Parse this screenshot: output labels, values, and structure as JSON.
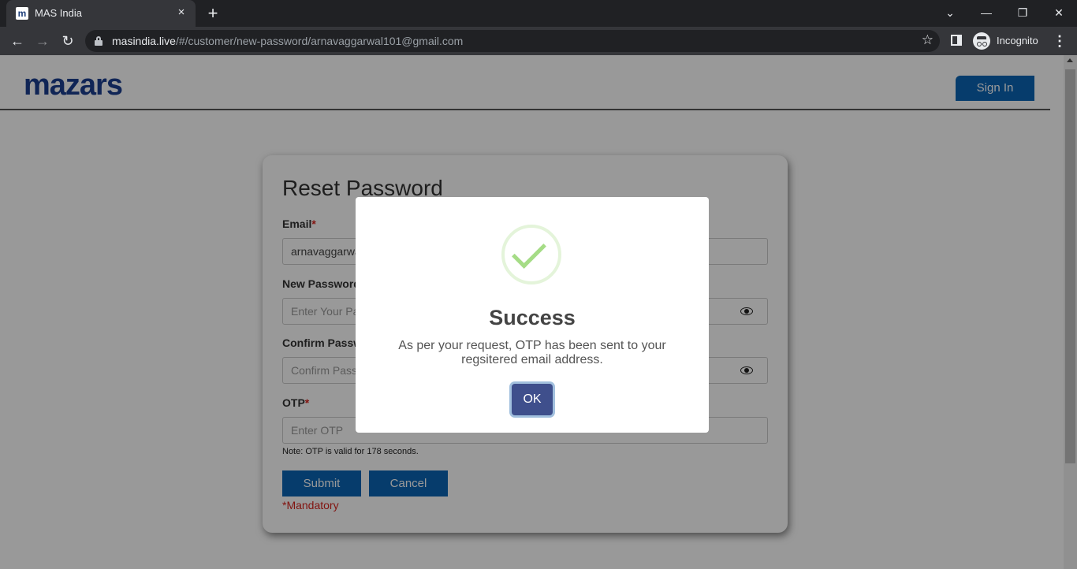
{
  "browser": {
    "tab_title": "MAS India",
    "favicon_letter": "m",
    "tab_close_icon": "×",
    "new_tab_icon": "+",
    "window_controls": {
      "chevron": "⌄",
      "minimize": "—",
      "restore": "❐",
      "close": "✕"
    },
    "back_icon": "←",
    "forward_icon": "→",
    "reload_icon": "↻",
    "url_host": "masindia.live",
    "url_path": "/#/customer/new-password/arnavaggarwal101@gmail.com",
    "star_icon": "☆",
    "incognito_label": "Incognito",
    "menu_icon": "⋮"
  },
  "header": {
    "logo_text": "mazars",
    "sign_in_label": "Sign In"
  },
  "form": {
    "title": "Reset Password",
    "email_label": "Email",
    "email_value": "arnavaggarwal101@gmail.com",
    "new_password_label": "New Password",
    "new_password_placeholder": "Enter Your Password",
    "confirm_password_label": "Confirm Password",
    "confirm_password_placeholder": "Confirm Password",
    "otp_label": "OTP",
    "otp_placeholder": "Enter OTP",
    "required_mark": "*",
    "note": "Note: OTP is valid for 178 seconds.",
    "submit_label": "Submit",
    "cancel_label": "Cancel",
    "mandatory_text": "*Mandatory"
  },
  "modal": {
    "title": "Success",
    "message": "As per your request, OTP has been sent to your regsitered email address.",
    "ok_label": "OK"
  },
  "colors": {
    "brand_blue": "#0a64b4",
    "logo_blue": "#1b3f8f",
    "ok_button": "#3f4f8c",
    "success_green": "#a5dc86",
    "required_red": "#d9231d"
  }
}
